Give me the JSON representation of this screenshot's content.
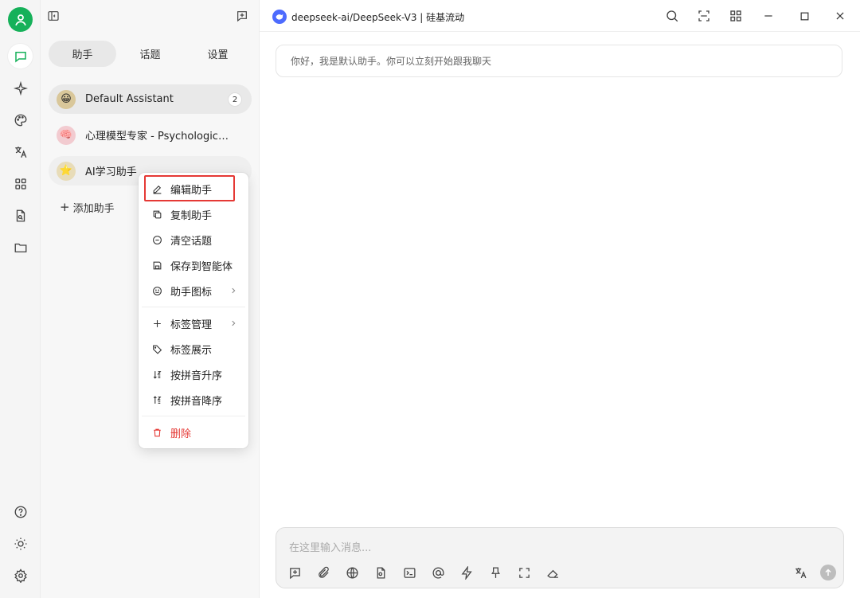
{
  "rail": {
    "icons": [
      "user-avatar",
      "chat-icon",
      "sparkle-icon",
      "palette-icon",
      "translate-icon",
      "apps-icon",
      "file-search-icon",
      "folder-icon",
      "help-icon",
      "theme-icon",
      "settings-icon"
    ]
  },
  "panel": {
    "tabs": [
      {
        "label": "助手"
      },
      {
        "label": "话题"
      },
      {
        "label": "设置"
      }
    ],
    "assistants": [
      {
        "name": "Default Assistant",
        "badge": "2",
        "emoji": "😀"
      },
      {
        "name": "心理模型专家 - Psychological Models Expert",
        "emoji": "🧠"
      },
      {
        "name": "AI学习助手",
        "emoji": "⭐"
      }
    ],
    "add_label": "添加助手"
  },
  "header": {
    "model_label": "deepseek-ai/DeepSeek-V3 | 硅基流动"
  },
  "chat": {
    "welcome": "你好，我是默认助手。你可以立刻开始跟我聊天"
  },
  "input": {
    "placeholder": "在这里输入消息..."
  },
  "context_menu": {
    "items": [
      {
        "label": "编辑助手",
        "icon": "edit-icon"
      },
      {
        "label": "复制助手",
        "icon": "copy-icon"
      },
      {
        "label": "清空话题",
        "icon": "clear-icon"
      },
      {
        "label": "保存到智能体",
        "icon": "save-icon"
      },
      {
        "label": "助手图标",
        "icon": "smile-icon",
        "submenu": true
      },
      {
        "label": "标签管理",
        "icon": "plus-icon",
        "submenu": true
      },
      {
        "label": "标签展示",
        "icon": "tags-icon"
      },
      {
        "label": "按拼音升序",
        "icon": "sort-asc-icon"
      },
      {
        "label": "按拼音降序",
        "icon": "sort-desc-icon"
      },
      {
        "label": "删除",
        "icon": "trash-icon",
        "danger": true
      }
    ]
  },
  "colors": {
    "accent_green": "#16b15a",
    "danger_red": "#e53935",
    "highlight_red": "#e53935",
    "deepseek_blue": "#4d6bfe"
  }
}
